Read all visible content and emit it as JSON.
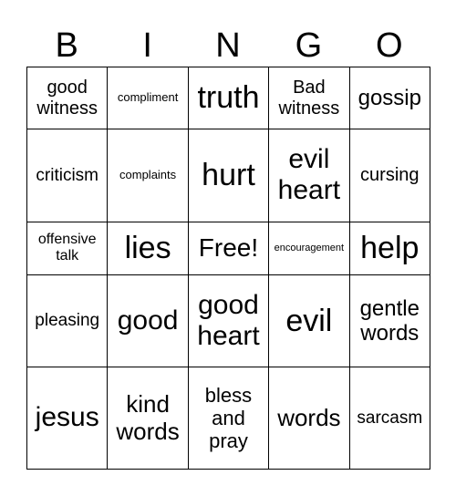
{
  "header": [
    "B",
    "I",
    "N",
    "G",
    "O"
  ],
  "rows": [
    [
      "good witness",
      "compliment",
      "truth",
      "Bad witness",
      "gossip"
    ],
    [
      "criticism",
      "complaints",
      "hurt",
      "evil heart",
      "cursing"
    ],
    [
      "offensive talk",
      "lies",
      "Free!",
      "encouragement",
      "help"
    ],
    [
      "pleasing",
      "good",
      "good heart",
      "evil",
      "gentle words"
    ],
    [
      "jesus",
      "kind words",
      "bless and pray",
      "words",
      "sarcasm"
    ]
  ]
}
